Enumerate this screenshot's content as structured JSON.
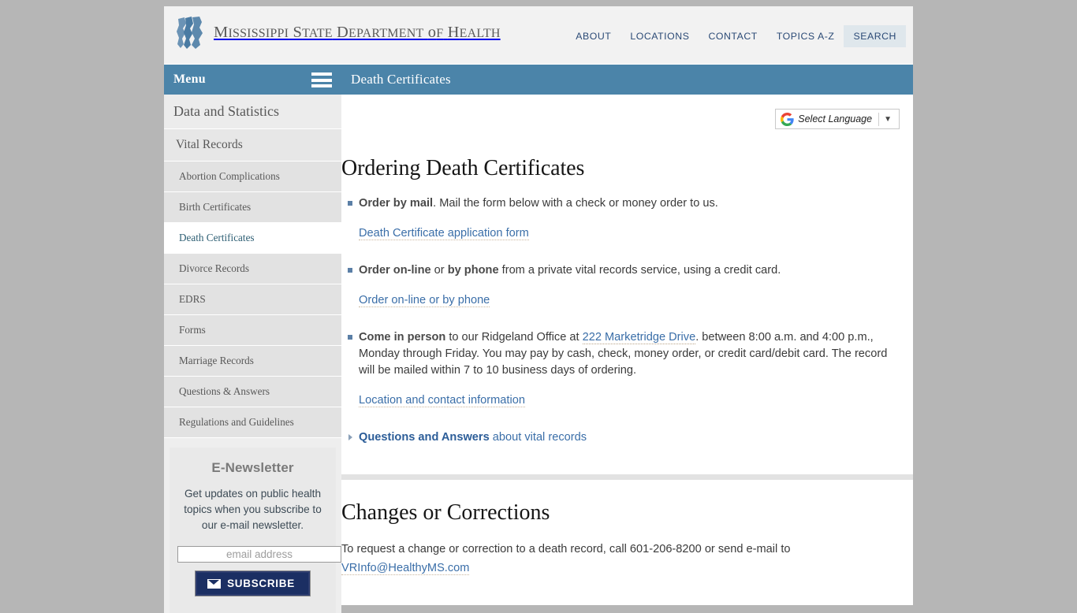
{
  "site": {
    "brand_name": "Mississippi State Department of Health",
    "logo_icon": "msdh-profile-logo-icon"
  },
  "topnav": {
    "items": [
      {
        "label": "ABOUT",
        "active": false
      },
      {
        "label": "LOCATIONS",
        "active": false
      },
      {
        "label": "CONTACT",
        "active": false
      },
      {
        "label": "TOPICS A-Z",
        "active": false
      },
      {
        "label": "SEARCH",
        "active": true
      }
    ]
  },
  "sidebar": {
    "menu_label": "Menu",
    "hamburger_icon": "hamburger-menu-icon",
    "items": [
      {
        "label": "Data and Statistics",
        "level": 1,
        "active": false
      },
      {
        "label": "Vital Records",
        "level": 2,
        "active": false
      },
      {
        "label": "Abortion Complications",
        "level": 3,
        "active": false
      },
      {
        "label": "Birth Certificates",
        "level": 3,
        "active": false
      },
      {
        "label": "Death Certificates",
        "level": 3,
        "active": true
      },
      {
        "label": "Divorce Records",
        "level": 3,
        "active": false
      },
      {
        "label": "EDRS",
        "level": 3,
        "active": false
      },
      {
        "label": "Forms",
        "level": 3,
        "active": false
      },
      {
        "label": "Marriage Records",
        "level": 3,
        "active": false
      },
      {
        "label": "Questions & Answers",
        "level": 3,
        "active": false
      },
      {
        "label": "Regulations and Guidelines",
        "level": 3,
        "active": false
      }
    ]
  },
  "newsletter": {
    "heading": "E-Newsletter",
    "description": "Get updates on public health topics when you subscribe to our e-mail newsletter.",
    "email_placeholder": "email address",
    "email_value": "",
    "subscribe_label": "SUBSCRIBE",
    "envelope_icon": "envelope-icon"
  },
  "main": {
    "page_title": "Death Certificates",
    "translate": {
      "google_icon": "google-g-icon",
      "label": "Select Language",
      "caret_icon": "chevron-down-icon"
    },
    "section1": {
      "heading": "Ordering Death Certificates",
      "bullets": [
        {
          "bold": "Order by mail",
          "rest": ". Mail the form below with a check or money order to us.",
          "link": "Death Certificate application form"
        },
        {
          "bold": "Order on-line",
          "mid": " or ",
          "bold2": "by phone",
          "rest": " from a private vital records service, using a credit card.",
          "link": "Order on-line or by phone"
        },
        {
          "bold": "Come in person",
          "pre_link": " to our Ridgeland Office at ",
          "inline_link": "222 Marketridge Drive",
          "rest": ". between 8:00 a.m. and 4:00 p.m., Monday through Friday. You may pay by cash, check, money order, or credit card/debit card. The record will be mailed within 7 to 10 business days of ordering.",
          "link": "Location and contact information"
        }
      ],
      "arrow_item": {
        "bold": "Questions and Answers",
        "rest": " about vital records"
      }
    },
    "section2": {
      "heading": "Changes or Corrections",
      "text_before": "To request a change or correction to a death record, call ",
      "phone": "601-206-8200",
      "text_after": " or send e-mail to ",
      "email": "VRInfo@HealthyMS.com"
    }
  },
  "colors": {
    "header_blue": "#4b84a9",
    "link_blue": "#3a6ea8",
    "nav_blue": "#2b4a76",
    "subscribe_navy": "#1b2f63",
    "page_bg": "#b6b6b6"
  }
}
